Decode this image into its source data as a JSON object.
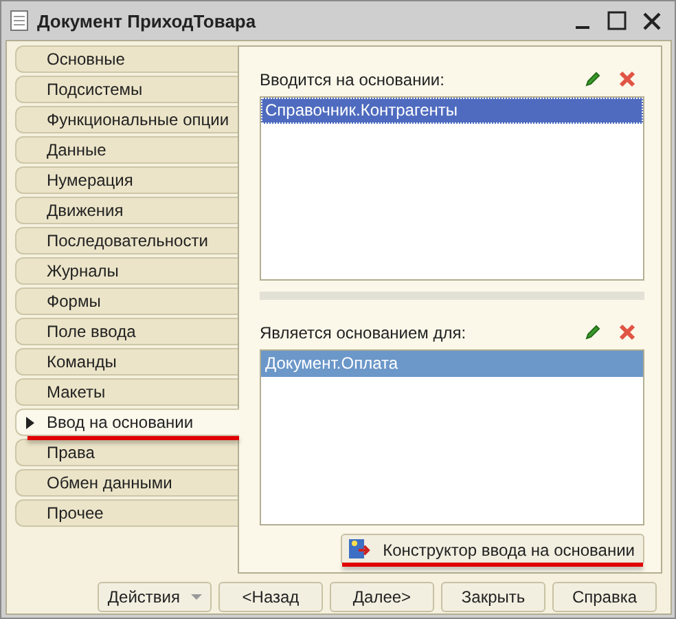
{
  "window": {
    "title": "Документ ПриходТовара"
  },
  "tabs": [
    {
      "label": "Основные",
      "selected": false,
      "underlined": false
    },
    {
      "label": "Подсистемы",
      "selected": false,
      "underlined": false
    },
    {
      "label": "Функциональные опции",
      "selected": false,
      "underlined": false
    },
    {
      "label": "Данные",
      "selected": false,
      "underlined": false
    },
    {
      "label": "Нумерация",
      "selected": false,
      "underlined": false
    },
    {
      "label": "Движения",
      "selected": false,
      "underlined": false
    },
    {
      "label": "Последовательности",
      "selected": false,
      "underlined": false
    },
    {
      "label": "Журналы",
      "selected": false,
      "underlined": false
    },
    {
      "label": "Формы",
      "selected": false,
      "underlined": false
    },
    {
      "label": "Поле ввода",
      "selected": false,
      "underlined": false
    },
    {
      "label": "Команды",
      "selected": false,
      "underlined": false
    },
    {
      "label": "Макеты",
      "selected": false,
      "underlined": false
    },
    {
      "label": "Ввод на основании",
      "selected": true,
      "underlined": true
    },
    {
      "label": "Права",
      "selected": false,
      "underlined": false
    },
    {
      "label": "Обмен данными",
      "selected": false,
      "underlined": false
    },
    {
      "label": "Прочее",
      "selected": false,
      "underlined": false
    }
  ],
  "lists": [
    {
      "label": "Вводится на основании:",
      "focused": true,
      "items": [
        {
          "text": "Справочник.Контрагенты",
          "selected": true
        }
      ]
    },
    {
      "label": "Является основанием для:",
      "focused": false,
      "items": [
        {
          "text": "Документ.Оплата",
          "selected": true
        }
      ]
    }
  ],
  "constructor_button": {
    "label": "Конструктор ввода на основании",
    "underlined": true
  },
  "footer_buttons": [
    {
      "label": "Действия",
      "kind": "dropdown"
    },
    {
      "label": "<Назад",
      "kind": "plain"
    },
    {
      "label": "Далее>",
      "kind": "plain"
    },
    {
      "label": "Закрыть",
      "kind": "plain"
    },
    {
      "label": "Справка",
      "kind": "plain"
    }
  ]
}
